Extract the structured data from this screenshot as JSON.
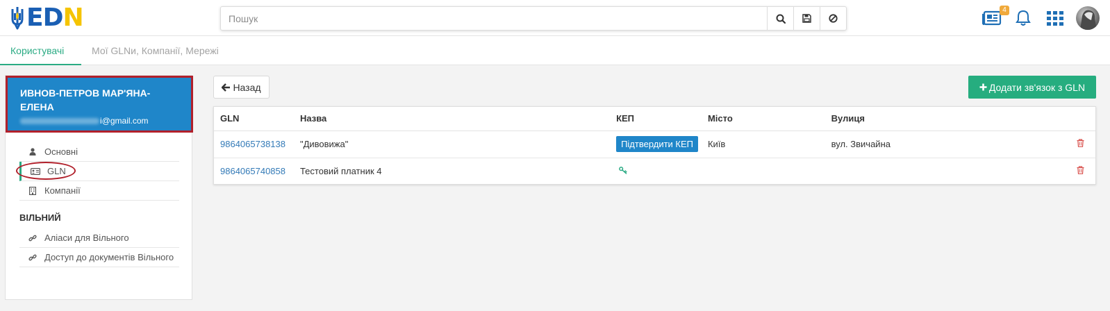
{
  "header": {
    "logo_text_ed": "ED",
    "logo_text_n": "N",
    "search_placeholder": "Пошук",
    "notifications_badge": "4",
    "icons": [
      "search-icon",
      "save-icon",
      "clear-icon",
      "news-icon",
      "bell-icon",
      "apps-grid-icon",
      "avatar"
    ]
  },
  "tabs": [
    {
      "label": "Користувачі",
      "active": true
    },
    {
      "label": "Мої GLNи, Компанії, Мережі",
      "active": false
    }
  ],
  "user": {
    "name": "ИВНОВ-ПЕТРОВ МАР'ЯНА-ЕЛЕНА",
    "email_visible": "i@gmail.com"
  },
  "menu": {
    "items": [
      {
        "label": "Основні",
        "icon": "user-icon"
      },
      {
        "label": "GLN",
        "icon": "id-card-icon",
        "active": true
      },
      {
        "label": "Компанії",
        "icon": "building-icon"
      }
    ],
    "section_title": "ВІЛЬНИЙ",
    "section_items": [
      {
        "label": "Аліаси для Вільного",
        "icon": "link-icon"
      },
      {
        "label": "Доступ до документів Вільного",
        "icon": "link-icon"
      }
    ]
  },
  "actions": {
    "back_label": "Назад",
    "add_label": "Додати зв'язок з GLN"
  },
  "table": {
    "columns": [
      "GLN",
      "Назва",
      "КЕП",
      "Місто",
      "Вулиця"
    ],
    "rows": [
      {
        "gln": "9864065738138",
        "name": "\"Дивовижа\"",
        "kep_button": "Підтвердити КЕП",
        "city": "Київ",
        "street": "вул. Звичайна"
      },
      {
        "gln": "9864065740858",
        "name": "Тестовий платник 4",
        "kep_icon": "key-icon",
        "city": "",
        "street": ""
      }
    ]
  },
  "colors": {
    "accent_green": "#2bab84",
    "primary_blue": "#1f86c9",
    "link_blue": "#337ab7",
    "highlight_red": "#b1202b",
    "delete_red": "#d9534f"
  }
}
